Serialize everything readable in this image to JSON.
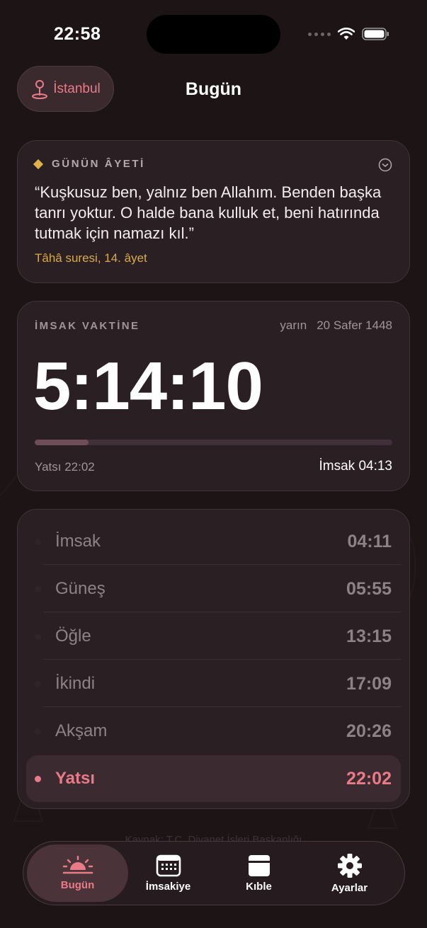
{
  "status_bar": {
    "time": "22:58"
  },
  "header": {
    "city": "İstanbul",
    "title": "Bugün"
  },
  "verse": {
    "label": "GÜNÜN ÂYETİ",
    "text": "“Kuşkusuz ben, yalnız ben Allahım. Benden başka tanrı yoktur. O halde bana kulluk et, beni hatırında tutmak için namazı kıl.”",
    "source": "Tâhâ suresi, 14. âyet"
  },
  "countdown": {
    "label": "İMSAK VAKTİNE",
    "day": "yarın",
    "hijri_date": "20 Safer 1448",
    "timer": "5:14:10",
    "progress": 0.15,
    "previous": "Yatsı 22:02",
    "next": "İmsak 04:13"
  },
  "prayer_times": [
    {
      "name": "İmsak",
      "time": "04:11"
    },
    {
      "name": "Güneş",
      "time": "05:55"
    },
    {
      "name": "Öğle",
      "time": "13:15"
    },
    {
      "name": "İkindi",
      "time": "17:09"
    },
    {
      "name": "Akşam",
      "time": "20:26"
    },
    {
      "name": "Yatsı",
      "time": "22:02",
      "active": true
    }
  ],
  "footer_note": "Kaynak: T.C. Diyanet İşleri Başkanlığı",
  "tabs": [
    {
      "label": "Bugün",
      "icon": "sunrise-icon",
      "active": true
    },
    {
      "label": "İmsakiye",
      "icon": "calendar-icon"
    },
    {
      "label": "Kıble",
      "icon": "kaaba-icon"
    },
    {
      "label": "Ayarlar",
      "icon": "gear-icon"
    }
  ],
  "colors": {
    "accent": "#e97b88",
    "gold": "#e0b24c",
    "background": "#1d1416",
    "card": "#2a1f22"
  }
}
